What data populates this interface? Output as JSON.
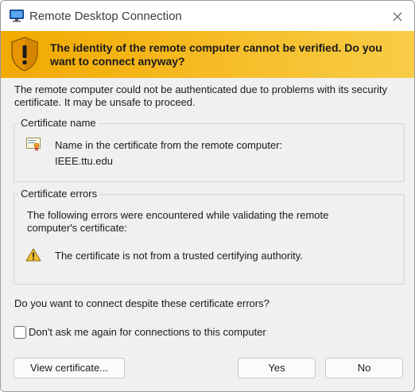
{
  "window": {
    "title": "Remote Desktop Connection",
    "icon": "remote-desktop-icon",
    "close_icon": "close-icon"
  },
  "banner": {
    "icon": "warning-shield-icon",
    "text": "The identity of the remote computer cannot be verified. Do you want to connect anyway?",
    "colors": {
      "start": "#f2a900",
      "end": "#f8cc47"
    }
  },
  "intro": "The remote computer could not be authenticated due to problems with its security certificate. It may be unsafe to proceed.",
  "certificate_name": {
    "label": "Certificate name",
    "icon": "certificate-icon",
    "line1": "Name in the certificate from the remote computer:",
    "line2": "IEEE.ttu.edu"
  },
  "certificate_errors": {
    "label": "Certificate errors",
    "description": "The following errors were encountered while validating the remote computer's certificate:",
    "icon": "warning-icon",
    "items": [
      "The certificate is not from a trusted certifying authority."
    ]
  },
  "question": "Do you want to connect despite these certificate errors?",
  "dont_ask": {
    "label": "Don't ask me again for connections to this computer",
    "checked": false
  },
  "buttons": {
    "view_certificate": "View certificate...",
    "yes": "Yes",
    "no": "No"
  }
}
